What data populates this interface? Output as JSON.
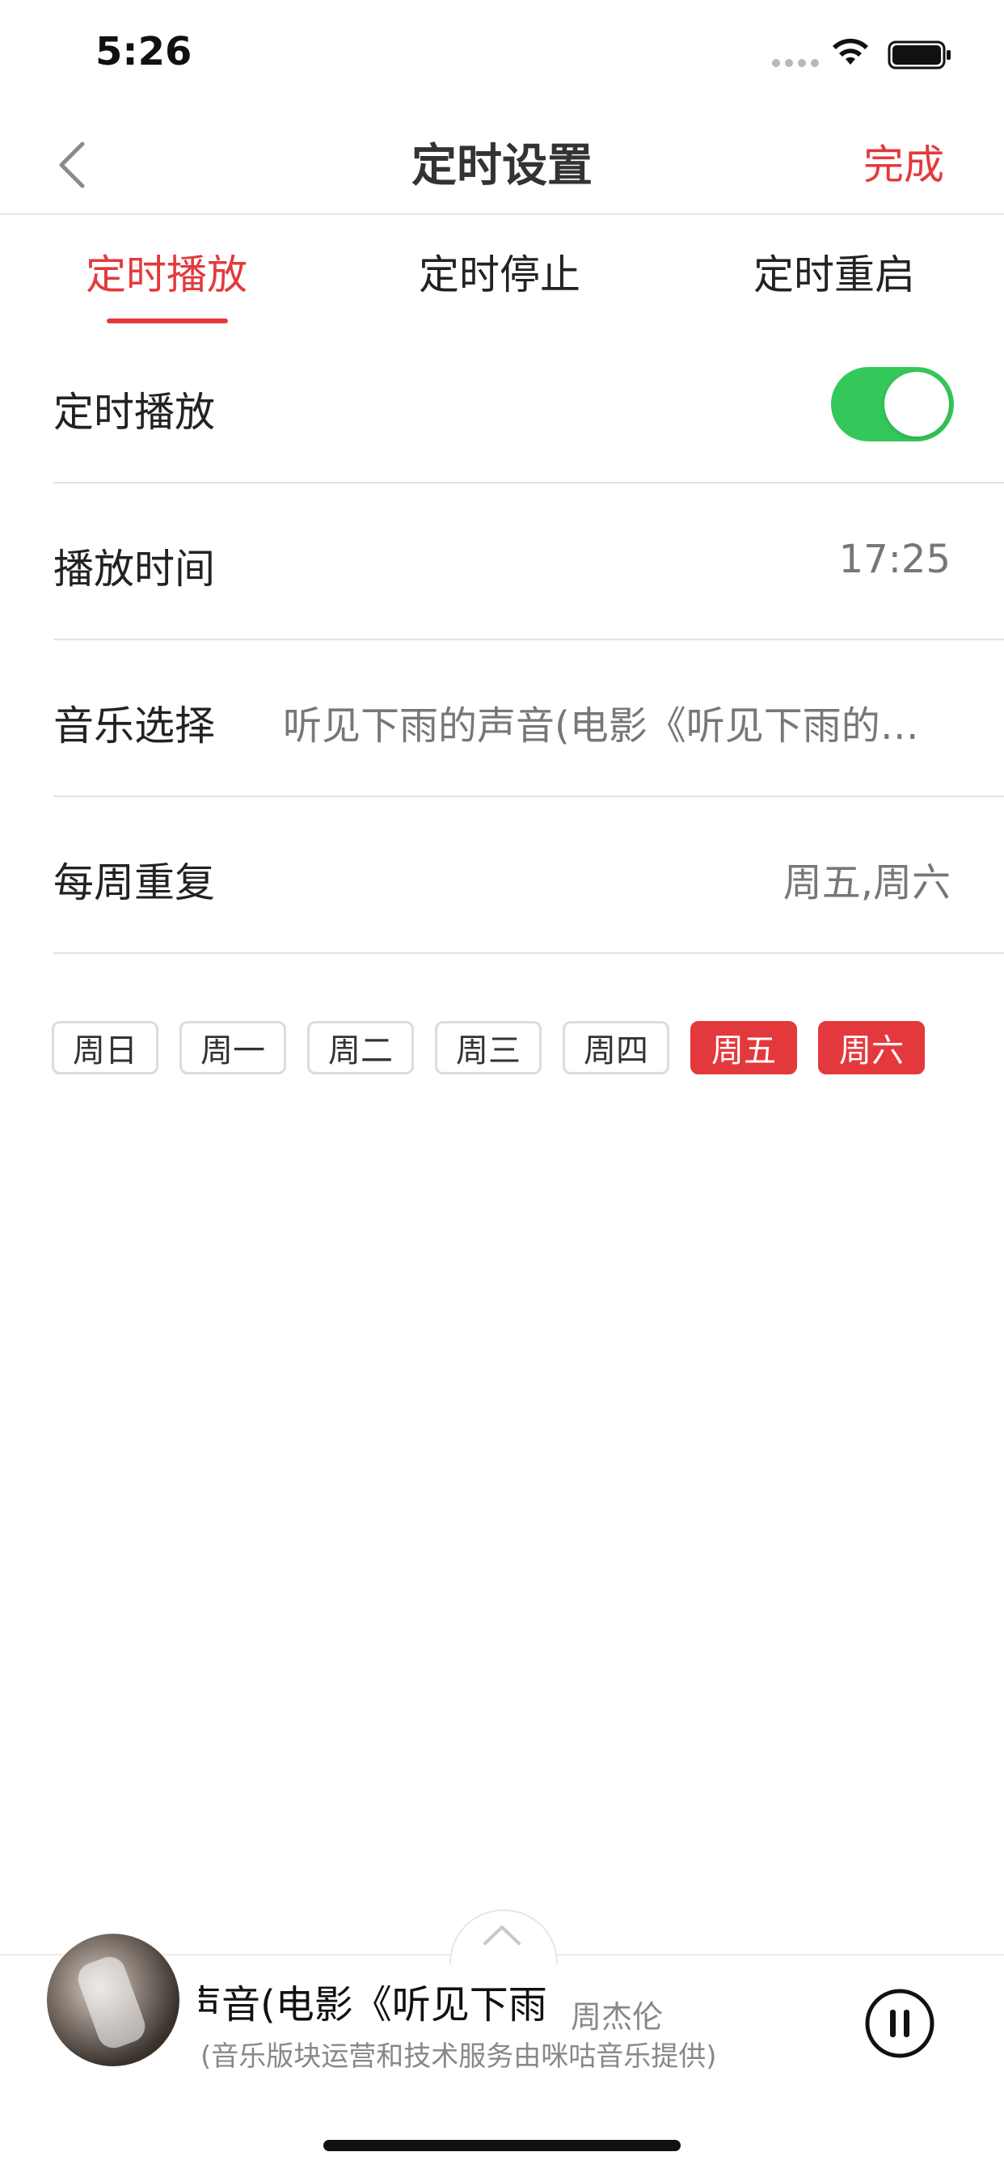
{
  "status_bar": {
    "time": "5:26"
  },
  "nav": {
    "title": "定时设置",
    "done_label": "完成"
  },
  "tabs": [
    {
      "label": "定时播放",
      "active": true
    },
    {
      "label": "定时停止",
      "active": false
    },
    {
      "label": "定时重启",
      "active": false
    }
  ],
  "settings": {
    "scheduled_play": {
      "label": "定时播放",
      "enabled": true
    },
    "play_time": {
      "label": "播放时间",
      "value": "17:25"
    },
    "music": {
      "label": "音乐选择",
      "value": "听见下雨的声音(电影《听见下雨的声音》主题曲)"
    },
    "weekly_repeat": {
      "label": "每周重复",
      "value": "周五,周六"
    }
  },
  "weekdays": [
    {
      "label": "周日",
      "selected": false
    },
    {
      "label": "周一",
      "selected": false
    },
    {
      "label": "周二",
      "selected": false
    },
    {
      "label": "周三",
      "selected": false
    },
    {
      "label": "周四",
      "selected": false
    },
    {
      "label": "周五",
      "selected": true
    },
    {
      "label": "周六",
      "selected": true
    }
  ],
  "player": {
    "title_visible": "声音(电影《听见下雨",
    "artist": "周杰伦",
    "subtitle": "(音乐版块运营和技术服务由咪咕音乐提供)"
  },
  "colors": {
    "accent": "#e4393c",
    "toggle_on": "#34c759"
  }
}
